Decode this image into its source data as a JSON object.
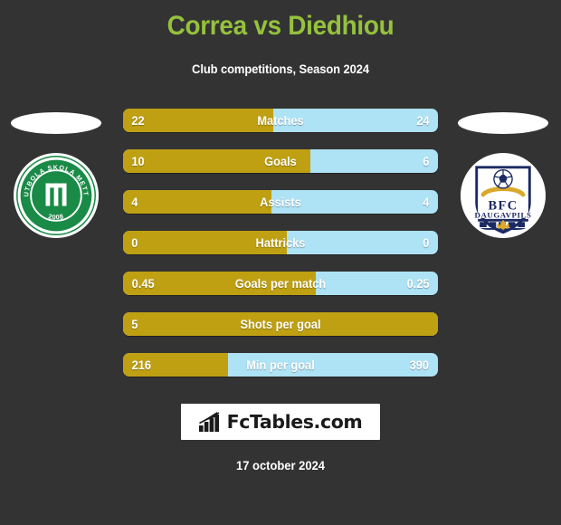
{
  "header": {
    "title": "Correa vs Diedhiou",
    "subtitle": "Club competitions, Season 2024",
    "title_color": "#95c13d"
  },
  "teams": {
    "left": {
      "name": "METTA",
      "crest_name": "futbola-skola-metta-crest",
      "crest_text_top": "FUTBOLA  SKOLA  METTA",
      "crest_year": "2008",
      "crest_monogram": "M",
      "crest_color": "#1a8a47"
    },
    "right": {
      "name": "BFC Daugavpils",
      "crest_name": "bfc-daugavpils-crest",
      "crest_line1": "BFC",
      "crest_line2": "DAUGAVPILS",
      "crest_color": "#1b2a63",
      "crest_accent": "#d9a92b"
    }
  },
  "legend": {
    "left_color": "#bfa012",
    "right_color": "#aee2f5"
  },
  "stats": [
    {
      "label": "Matches",
      "left": "22",
      "right": "24",
      "left_pct": 47.8
    },
    {
      "label": "Goals",
      "left": "10",
      "right": "6",
      "left_pct": 59.5
    },
    {
      "label": "Assists",
      "left": "4",
      "right": "4",
      "left_pct": 47.1
    },
    {
      "label": "Hattricks",
      "left": "0",
      "right": "0",
      "left_pct": 52.0
    },
    {
      "label": "Goals per match",
      "left": "0.45",
      "right": "0.25",
      "left_pct": 61.2
    },
    {
      "label": "Shots per goal",
      "left": "5",
      "right": "",
      "left_pct": 100
    },
    {
      "label": "Min per goal",
      "left": "216",
      "right": "390",
      "left_pct": 33.3
    }
  ],
  "footer": {
    "brand": "FcTables.com",
    "brand_icon": "bar-chart-icon",
    "date": "17 october 2024"
  }
}
